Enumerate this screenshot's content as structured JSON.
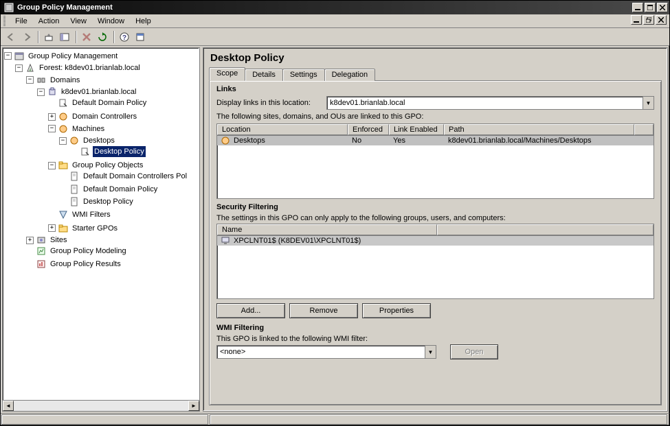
{
  "window": {
    "title": "Group Policy Management"
  },
  "menubar": {
    "file": "File",
    "action": "Action",
    "view": "View",
    "window": "Window",
    "help": "Help"
  },
  "tree": {
    "root": "Group Policy Management",
    "forest": "Forest: k8dev01.brianlab.local",
    "domains": "Domains",
    "domain0": "k8dev01.brianlab.local",
    "default_domain_policy": "Default Domain Policy",
    "domain_controllers": "Domain Controllers",
    "machines": "Machines",
    "desktops": "Desktops",
    "desktop_policy": "Desktop Policy",
    "gpo": "Group Policy Objects",
    "default_dc_policy": "Default Domain Controllers Pol",
    "gpo_default_domain_policy": "Default Domain Policy",
    "gpo_desktop_policy": "Desktop Policy",
    "wmi_filters": "WMI Filters",
    "starter_gpos": "Starter GPOs",
    "sites": "Sites",
    "gp_modeling": "Group Policy Modeling",
    "gp_results": "Group Policy Results"
  },
  "detail": {
    "title": "Desktop Policy",
    "tabs": {
      "scope": "Scope",
      "details": "Details",
      "settings": "Settings",
      "delegation": "Delegation"
    },
    "links": {
      "heading": "Links",
      "display_label": "Display links in this location:",
      "location_value": "k8dev01.brianlab.local",
      "list_hint": "The following sites, domains, and OUs are linked to this GPO:",
      "columns": {
        "location": "Location",
        "enforced": "Enforced",
        "link_enabled": "Link Enabled",
        "path": "Path"
      },
      "rows": [
        {
          "location": "Desktops",
          "enforced": "No",
          "link_enabled": "Yes",
          "path": "k8dev01.brianlab.local/Machines/Desktops"
        }
      ]
    },
    "security": {
      "heading": "Security Filtering",
      "hint": "The settings in this GPO can only apply to the following groups, users, and computers:",
      "columns": {
        "name": "Name"
      },
      "rows": [
        {
          "name": "XPCLNT01$ (K8DEV01\\XPCLNT01$)"
        }
      ],
      "buttons": {
        "add": "Add...",
        "remove": "Remove",
        "properties": "Properties"
      }
    },
    "wmi": {
      "heading": "WMI Filtering",
      "hint": "This GPO is linked to the following WMI filter:",
      "value": "<none>",
      "open": "Open"
    }
  }
}
